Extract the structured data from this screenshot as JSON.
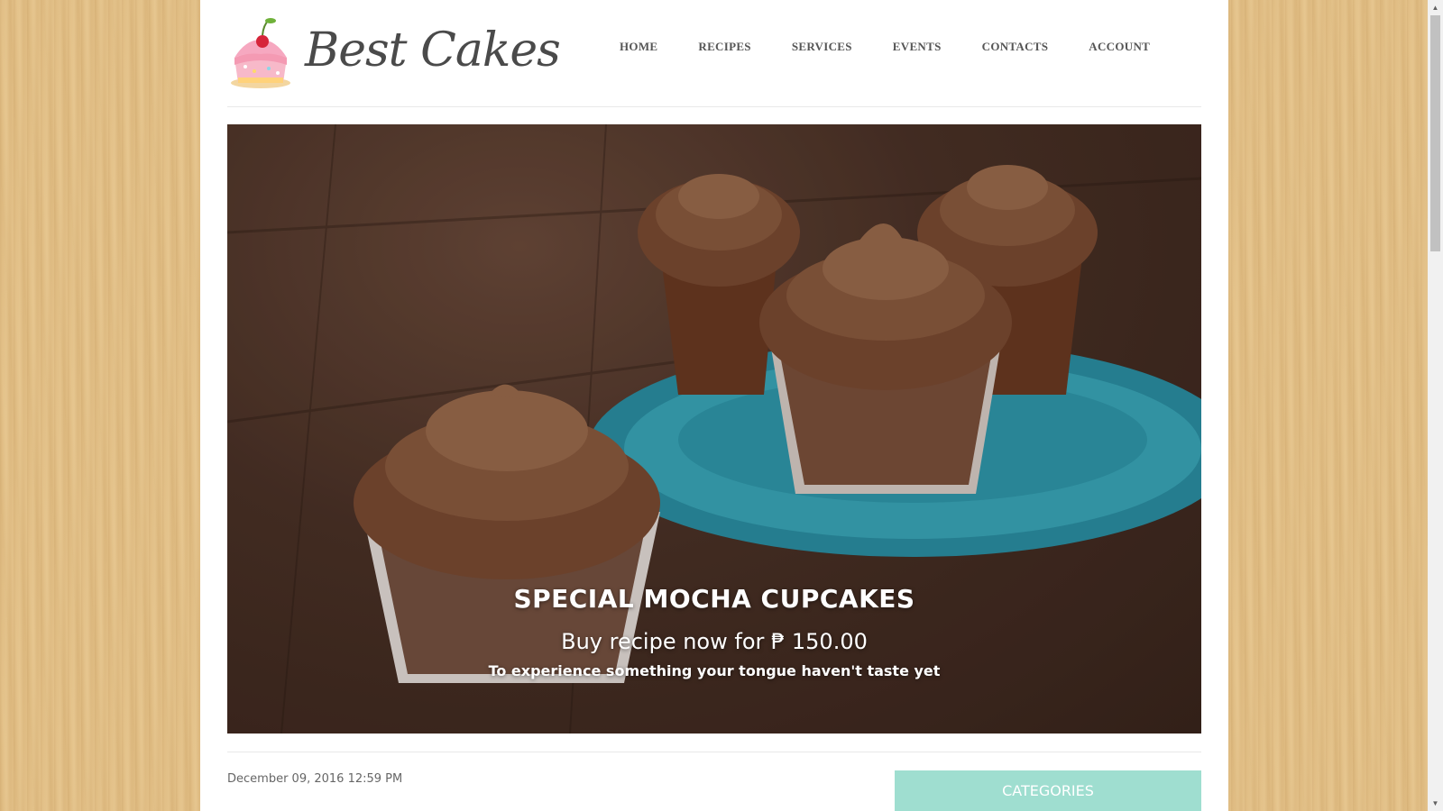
{
  "brand": {
    "name": "Best Cakes",
    "logo_icon": "cupcake-icon"
  },
  "nav": [
    "HOME",
    "RECIPES",
    "SERVICES",
    "EVENTS",
    "CONTACTS",
    "ACCOUNT"
  ],
  "hero": {
    "title": "SPECIAL MOCHA CUPCAKES",
    "subtitle": "Buy recipe now for ₱ 150.00",
    "tagline": "To experience something your tongue haven't taste yet"
  },
  "post": {
    "date": "December 09, 2016 12:59 PM"
  },
  "sidebar": {
    "categories_title": "CATEGORIES"
  },
  "colors": {
    "accent": "#9fded0",
    "nav_text": "#555555",
    "page_bg": "#ffffff"
  }
}
